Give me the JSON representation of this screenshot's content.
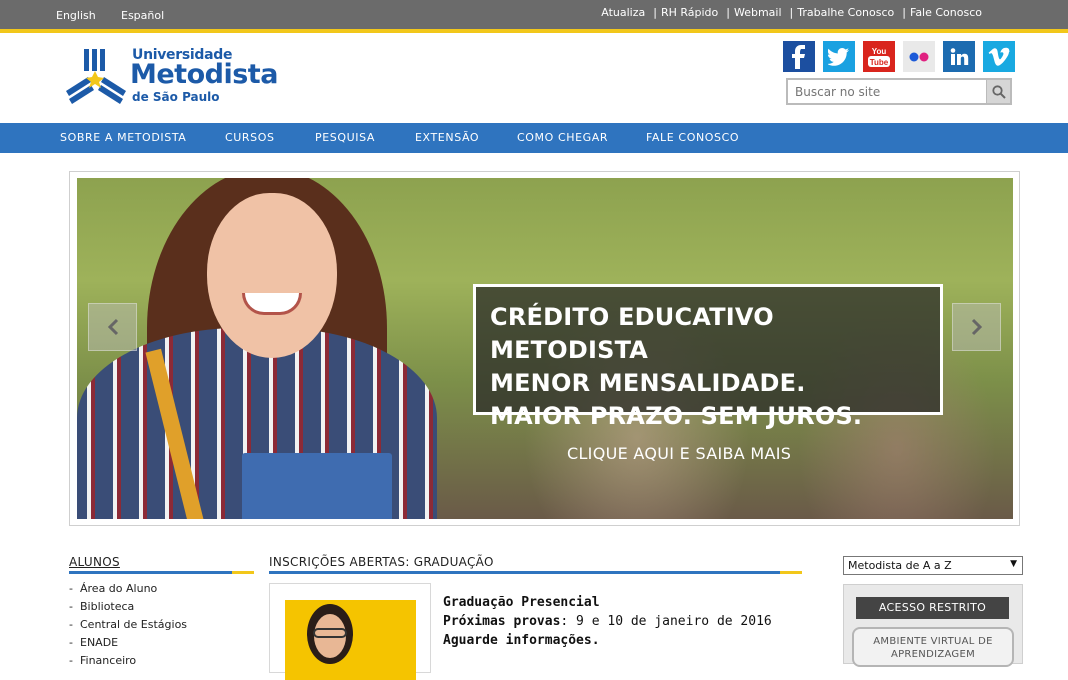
{
  "topbar": {
    "languages": [
      "English",
      "Español"
    ],
    "links": [
      "Atualiza",
      "RH Rápido",
      "Webmail",
      "Trabalhe Conosco",
      "Fale Conosco"
    ]
  },
  "logo": {
    "line1": "Universidade",
    "line2": "Metodista",
    "line3": "de São Paulo",
    "color": "#1c5aa8"
  },
  "social": [
    {
      "icon": "facebook-icon",
      "glyph": "f",
      "color": "#1c4fa0"
    },
    {
      "icon": "twitter-icon",
      "glyph": "t",
      "color": "#1aa1e1"
    },
    {
      "icon": "youtube-icon",
      "glyph": "You Tube",
      "color": "#d9251d"
    },
    {
      "icon": "flickr-icon",
      "glyph": "●●",
      "color": "#e9e9e9"
    },
    {
      "icon": "linkedin-icon",
      "glyph": "in",
      "color": "#1c6bb0"
    },
    {
      "icon": "vimeo-icon",
      "glyph": "v",
      "color": "#19a9e1"
    }
  ],
  "search": {
    "placeholder": "Buscar no site"
  },
  "nav": [
    "SOBRE A METODISTA",
    "CURSOS",
    "PESQUISA",
    "EXTENSÃO",
    "COMO CHEGAR",
    "FALE CONOSCO"
  ],
  "hero": {
    "caption_lines": [
      "CRÉDITO EDUCATIVO METODISTA",
      "MENOR MENSALIDADE.",
      "MAIOR PRAZO. SEM JUROS."
    ],
    "cta": "CLIQUE AQUI E SAIBA MAIS"
  },
  "alunos": {
    "title": "ALUNOS",
    "items": [
      "Área do Aluno",
      "Biblioteca",
      "Central de Estágios",
      "ENADE",
      "Financeiro"
    ]
  },
  "inscricoes": {
    "title": "INSCRIÇÕES ABERTAS: GRADUAÇÃO",
    "news_title": "Graduação Presencial",
    "news_label": "Próximas provas",
    "news_value": ": 9 e 10 de janeiro de 2016",
    "news_note": "Aguarde informações."
  },
  "right": {
    "select_value": "Metodista de A a Z",
    "restricted_title": "ACESSO RESTRITO",
    "restricted_button": "AMBIENTE VIRTUAL DE APRENDIZAGEM"
  }
}
